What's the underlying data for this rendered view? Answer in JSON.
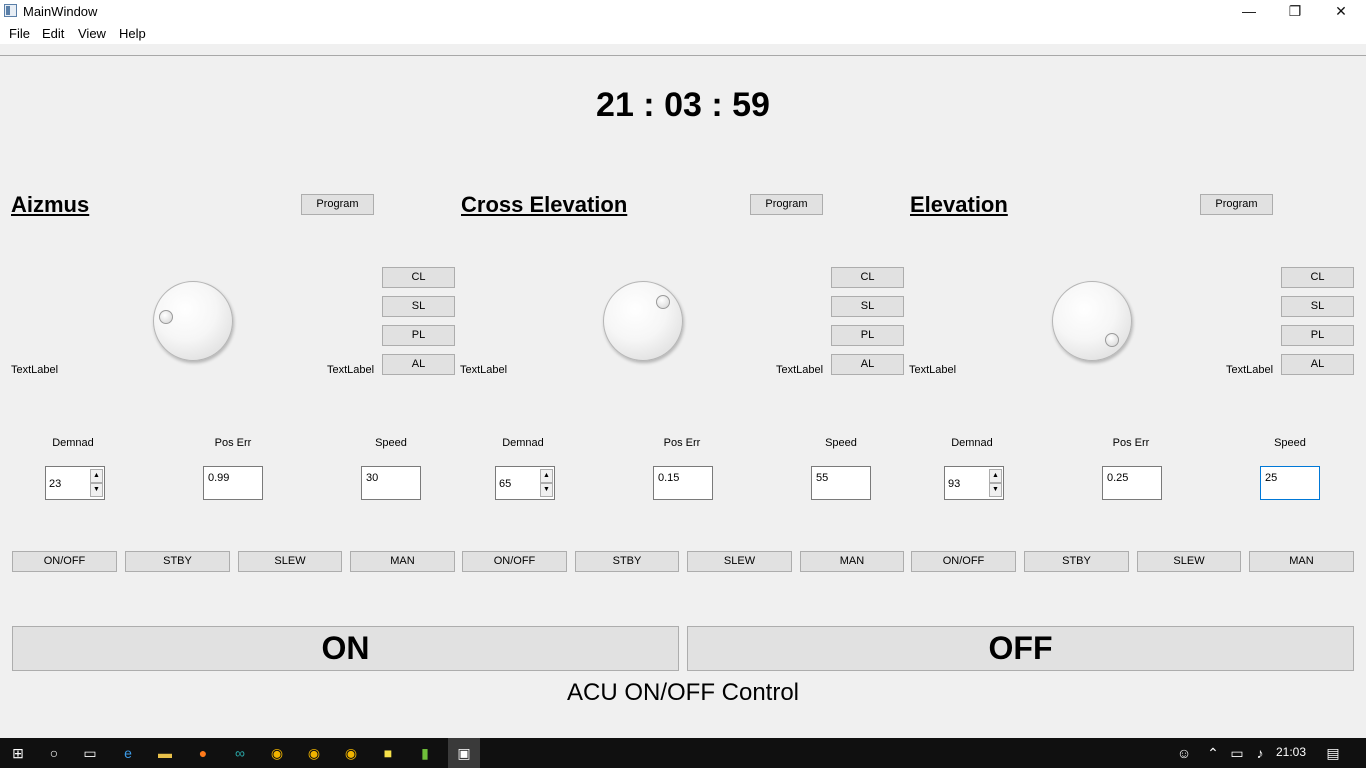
{
  "window": {
    "title": "MainWindow",
    "minimize": "—",
    "maximize": "❐",
    "close": "✕"
  },
  "menu": [
    "File",
    "Edit",
    "View",
    "Help"
  ],
  "clock": "21 : 03 : 59",
  "sections": [
    {
      "heading": "Aizmus",
      "program": "Program",
      "side_buttons": [
        "CL",
        "SL",
        "PL",
        "AL"
      ],
      "text_label_left": "TextLabel",
      "text_label_right": "TextLabel",
      "field_labels": [
        "Demnad",
        "Pos Err",
        "Speed"
      ],
      "demand": "23",
      "pos_err": "0.99",
      "speed": "30",
      "modes": [
        "ON/OFF",
        "STBY",
        "SLEW",
        "MAN"
      ]
    },
    {
      "heading": "Cross Elevation",
      "program": "Program",
      "side_buttons": [
        "CL",
        "SL",
        "PL",
        "AL"
      ],
      "text_label_left": "TextLabel",
      "text_label_right": "TextLabel",
      "field_labels": [
        "Demnad",
        "Pos Err",
        "Speed"
      ],
      "demand": "65",
      "pos_err": "0.15",
      "speed": "55",
      "modes": [
        "ON/OFF",
        "STBY",
        "SLEW",
        "MAN"
      ]
    },
    {
      "heading": "Elevation",
      "program": "Program",
      "side_buttons": [
        "CL",
        "SL",
        "PL",
        "AL"
      ],
      "text_label_left": "TextLabel",
      "text_label_right": "TextLabel",
      "field_labels": [
        "Demnad",
        "Pos Err",
        "Speed"
      ],
      "demand": "93",
      "pos_err": "0.25",
      "speed": "25",
      "modes": [
        "ON/OFF",
        "STBY",
        "SLEW",
        "MAN"
      ]
    }
  ],
  "acu": {
    "on": "ON",
    "off": "OFF",
    "label": "ACU ON/OFF Control"
  },
  "taskbar": {
    "time": "21:03",
    "icons": [
      "windows-start-icon",
      "search-icon",
      "task-view-icon",
      "edge-icon",
      "file-explorer-icon",
      "firefox-icon",
      "arduino-icon",
      "chrome-icon",
      "chrome-icon",
      "chrome-icon",
      "sticky-notes-icon",
      "qt-creator-icon",
      "app-window-icon"
    ]
  }
}
